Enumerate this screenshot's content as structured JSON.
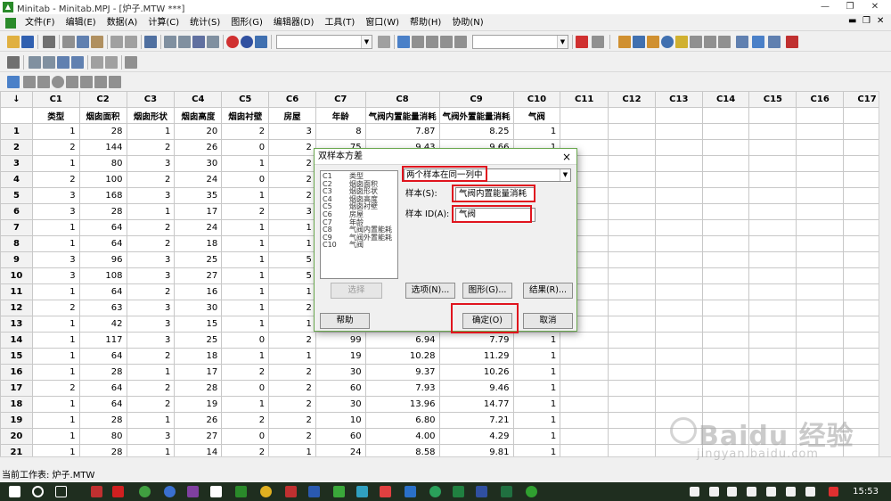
{
  "window": {
    "title": "Minitab - Minitab.MPJ - [炉子.MTW ***]"
  },
  "menu": [
    "文件(F)",
    "编辑(E)",
    "数据(A)",
    "计算(C)",
    "统计(S)",
    "图形(G)",
    "编辑器(D)",
    "工具(T)",
    "窗口(W)",
    "帮助(H)",
    "协助(N)"
  ],
  "worksheet": {
    "row_header_symbol": "↓",
    "columns": [
      "C1",
      "C2",
      "C3",
      "C4",
      "C5",
      "C6",
      "C7",
      "C8",
      "C9",
      "C10",
      "C11",
      "C12",
      "C13",
      "C14",
      "C15",
      "C16",
      "C17"
    ],
    "names": [
      "类型",
      "烟囱面积",
      "烟囱形状",
      "烟囱高度",
      "烟囱衬壁",
      "房屋",
      "年龄",
      "气阀内置能量消耗",
      "气阀外置能量消耗",
      "气阀",
      "",
      "",
      "",
      "",
      "",
      "",
      ""
    ],
    "rows": [
      {
        "n": "1",
        "c": [
          "1",
          "28",
          "1",
          "20",
          "2",
          "3",
          "8",
          "7.87",
          "8.25",
          "1"
        ]
      },
      {
        "n": "2",
        "c": [
          "2",
          "144",
          "2",
          "26",
          "0",
          "2",
          "75",
          "9.43",
          "9.66",
          "1"
        ]
      },
      {
        "n": "3",
        "c": [
          "1",
          "80",
          "3",
          "30",
          "1",
          "2",
          "",
          "",
          "",
          ""
        ]
      },
      {
        "n": "4",
        "c": [
          "2",
          "100",
          "2",
          "24",
          "0",
          "2",
          "",
          "",
          "",
          ""
        ]
      },
      {
        "n": "5",
        "c": [
          "3",
          "168",
          "3",
          "35",
          "1",
          "2",
          "",
          "",
          "",
          ""
        ]
      },
      {
        "n": "6",
        "c": [
          "3",
          "28",
          "1",
          "17",
          "2",
          "3",
          "",
          "",
          "",
          ""
        ]
      },
      {
        "n": "7",
        "c": [
          "1",
          "64",
          "2",
          "24",
          "1",
          "1",
          "",
          "",
          "",
          ""
        ]
      },
      {
        "n": "8",
        "c": [
          "1",
          "64",
          "2",
          "18",
          "1",
          "1",
          "",
          "",
          "",
          ""
        ]
      },
      {
        "n": "9",
        "c": [
          "3",
          "96",
          "3",
          "25",
          "1",
          "5",
          "",
          "",
          "",
          ""
        ]
      },
      {
        "n": "10",
        "c": [
          "3",
          "108",
          "3",
          "27",
          "1",
          "5",
          "",
          "",
          "",
          ""
        ]
      },
      {
        "n": "11",
        "c": [
          "1",
          "64",
          "2",
          "16",
          "1",
          "1",
          "",
          "",
          "",
          ""
        ]
      },
      {
        "n": "12",
        "c": [
          "2",
          "63",
          "3",
          "30",
          "1",
          "2",
          "",
          "",
          "",
          ""
        ]
      },
      {
        "n": "13",
        "c": [
          "1",
          "42",
          "3",
          "15",
          "1",
          "1",
          "",
          "",
          "",
          ""
        ]
      },
      {
        "n": "14",
        "c": [
          "1",
          "117",
          "3",
          "25",
          "0",
          "2",
          "99",
          "6.94",
          "7.79",
          "1"
        ]
      },
      {
        "n": "15",
        "c": [
          "1",
          "64",
          "2",
          "18",
          "1",
          "1",
          "19",
          "10.28",
          "11.29",
          "1"
        ]
      },
      {
        "n": "16",
        "c": [
          "1",
          "28",
          "1",
          "17",
          "2",
          "2",
          "30",
          "9.37",
          "10.26",
          "1"
        ]
      },
      {
        "n": "17",
        "c": [
          "2",
          "64",
          "2",
          "28",
          "0",
          "2",
          "60",
          "7.93",
          "9.46",
          "1"
        ]
      },
      {
        "n": "18",
        "c": [
          "1",
          "64",
          "2",
          "19",
          "1",
          "2",
          "30",
          "13.96",
          "14.77",
          "1"
        ]
      },
      {
        "n": "19",
        "c": [
          "1",
          "28",
          "1",
          "26",
          "2",
          "2",
          "10",
          "6.80",
          "7.21",
          "1"
        ]
      },
      {
        "n": "20",
        "c": [
          "1",
          "80",
          "3",
          "27",
          "0",
          "2",
          "60",
          "4.00",
          "4.29",
          "1"
        ]
      },
      {
        "n": "21",
        "c": [
          "1",
          "28",
          "1",
          "14",
          "2",
          "1",
          "24",
          "8.58",
          "9.81",
          "1"
        ]
      }
    ]
  },
  "dialog": {
    "title": "双样本方差",
    "close": "×",
    "variables": [
      {
        "col": "C1",
        "name": "类型"
      },
      {
        "col": "C2",
        "name": "烟囱面积"
      },
      {
        "col": "C3",
        "name": "烟囱形状"
      },
      {
        "col": "C4",
        "name": "烟囱高度"
      },
      {
        "col": "C5",
        "name": "烟囱衬壁"
      },
      {
        "col": "C6",
        "name": "房屋"
      },
      {
        "col": "C7",
        "name": "年龄"
      },
      {
        "col": "C8",
        "name": "气阀内置能耗"
      },
      {
        "col": "C9",
        "name": "气阀外置能耗"
      },
      {
        "col": "C10",
        "name": "气阀"
      }
    ],
    "mode_value": "两个样本在同一列中",
    "samples_label": "样本(S):",
    "samples_value": "气阀内置能量消耗",
    "sample_id_label": "样本 ID(A):",
    "sample_id_value": "气阀",
    "select_button": "选择",
    "options_button": "选项(N)...",
    "graphs_button": "图形(G)...",
    "results_button": "结果(R)...",
    "help_button": "帮助",
    "ok_button": "确定(O)",
    "cancel_button": "取消"
  },
  "status": {
    "current_worksheet": "当前工作表: 炉子.MTW"
  },
  "taskbar": {
    "time": "15:53"
  },
  "watermark": {
    "main": "Baidu 经验",
    "sub": "jingyan.baidu.com"
  },
  "colors": {
    "dialog_border": "#6aa84f",
    "highlight": "#e0141e",
    "taskbar": "#1f2e1f"
  }
}
